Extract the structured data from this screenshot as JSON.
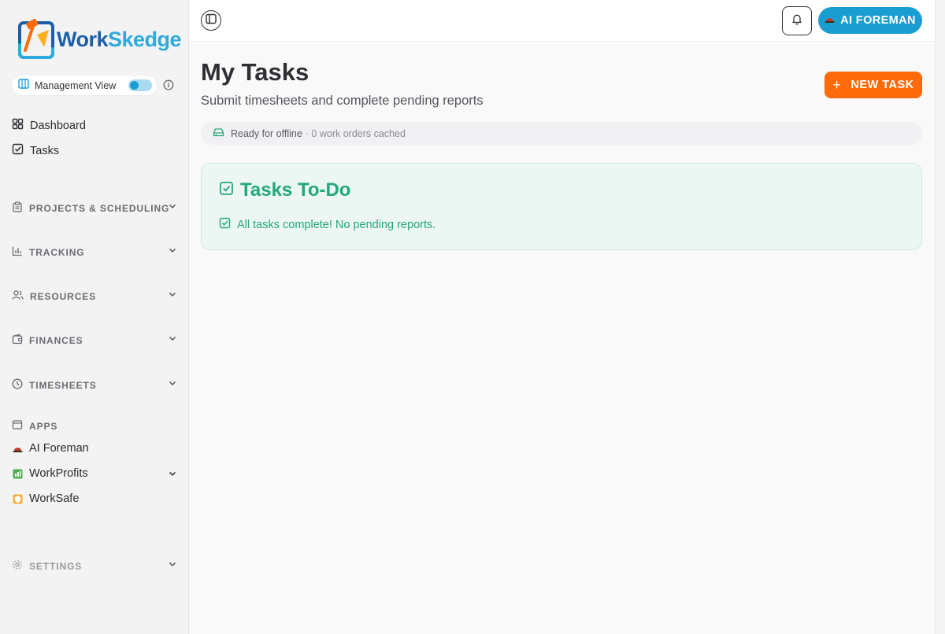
{
  "brand": {
    "name_part1": "Work",
    "name_part2": "Skedge",
    "primary_color": "#1c5fa8",
    "accent_color": "#2eaadc"
  },
  "sidebar": {
    "management_view": {
      "label": "Management View",
      "enabled": true
    },
    "nav": [
      {
        "label": "Dashboard",
        "icon": "dashboard-icon"
      },
      {
        "label": "Tasks",
        "icon": "checkbox-icon"
      }
    ],
    "sections": [
      {
        "label": "PROJECTS & SCHEDULING",
        "icon": "clipboard-icon"
      },
      {
        "label": "TRACKING",
        "icon": "bar-chart-icon"
      },
      {
        "label": "RESOURCES",
        "icon": "users-icon"
      },
      {
        "label": "FINANCES",
        "icon": "wallet-icon"
      },
      {
        "label": "TIMESHEETS",
        "icon": "clock-icon"
      }
    ],
    "apps": {
      "label": "APPS",
      "items": [
        {
          "label": "AI Foreman",
          "icon": "hard-hat-icon"
        },
        {
          "label": "WorkProfits",
          "icon": "workprofits-icon"
        },
        {
          "label": "WorkSafe",
          "icon": "worksafe-icon"
        }
      ]
    },
    "settings_label": "SETTINGS"
  },
  "header": {
    "ai_foreman_label": "AI FOREMAN",
    "ai_foreman_color": "#1a9dd1"
  },
  "main": {
    "title": "My Tasks",
    "subtitle": "Submit timesheets and complete pending reports",
    "new_task_label": "NEW TASK",
    "new_task_color": "#ff6b0a",
    "offline_status": {
      "ready": "Ready for offline",
      "cached": "· 0 work orders cached"
    },
    "todo": {
      "title": "Tasks To-Do",
      "message": "All tasks complete! No pending reports.",
      "color": "#23a87a"
    }
  }
}
